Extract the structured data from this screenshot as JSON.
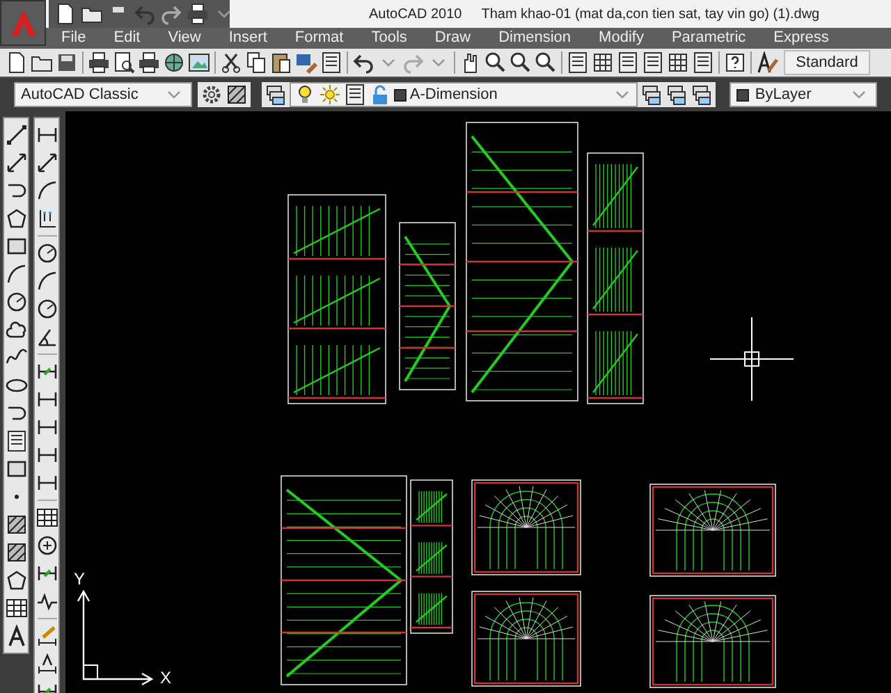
{
  "window": {
    "app_title": "AutoCAD 2010",
    "file_title": "Tham khao-01 (mat da,con tien sat, tay vin go) (1).dwg"
  },
  "menu": [
    "File",
    "Edit",
    "View",
    "Insert",
    "Format",
    "Tools",
    "Draw",
    "Dimension",
    "Modify",
    "Parametric",
    "Express"
  ],
  "toolbar": {
    "text_style": "Standard"
  },
  "workspace": {
    "value": "AutoCAD Classic"
  },
  "layer": {
    "value": "A-Dimension"
  },
  "color": {
    "value": "ByLayer"
  },
  "ucs": {
    "y_label": "Y",
    "x_label": "X"
  }
}
